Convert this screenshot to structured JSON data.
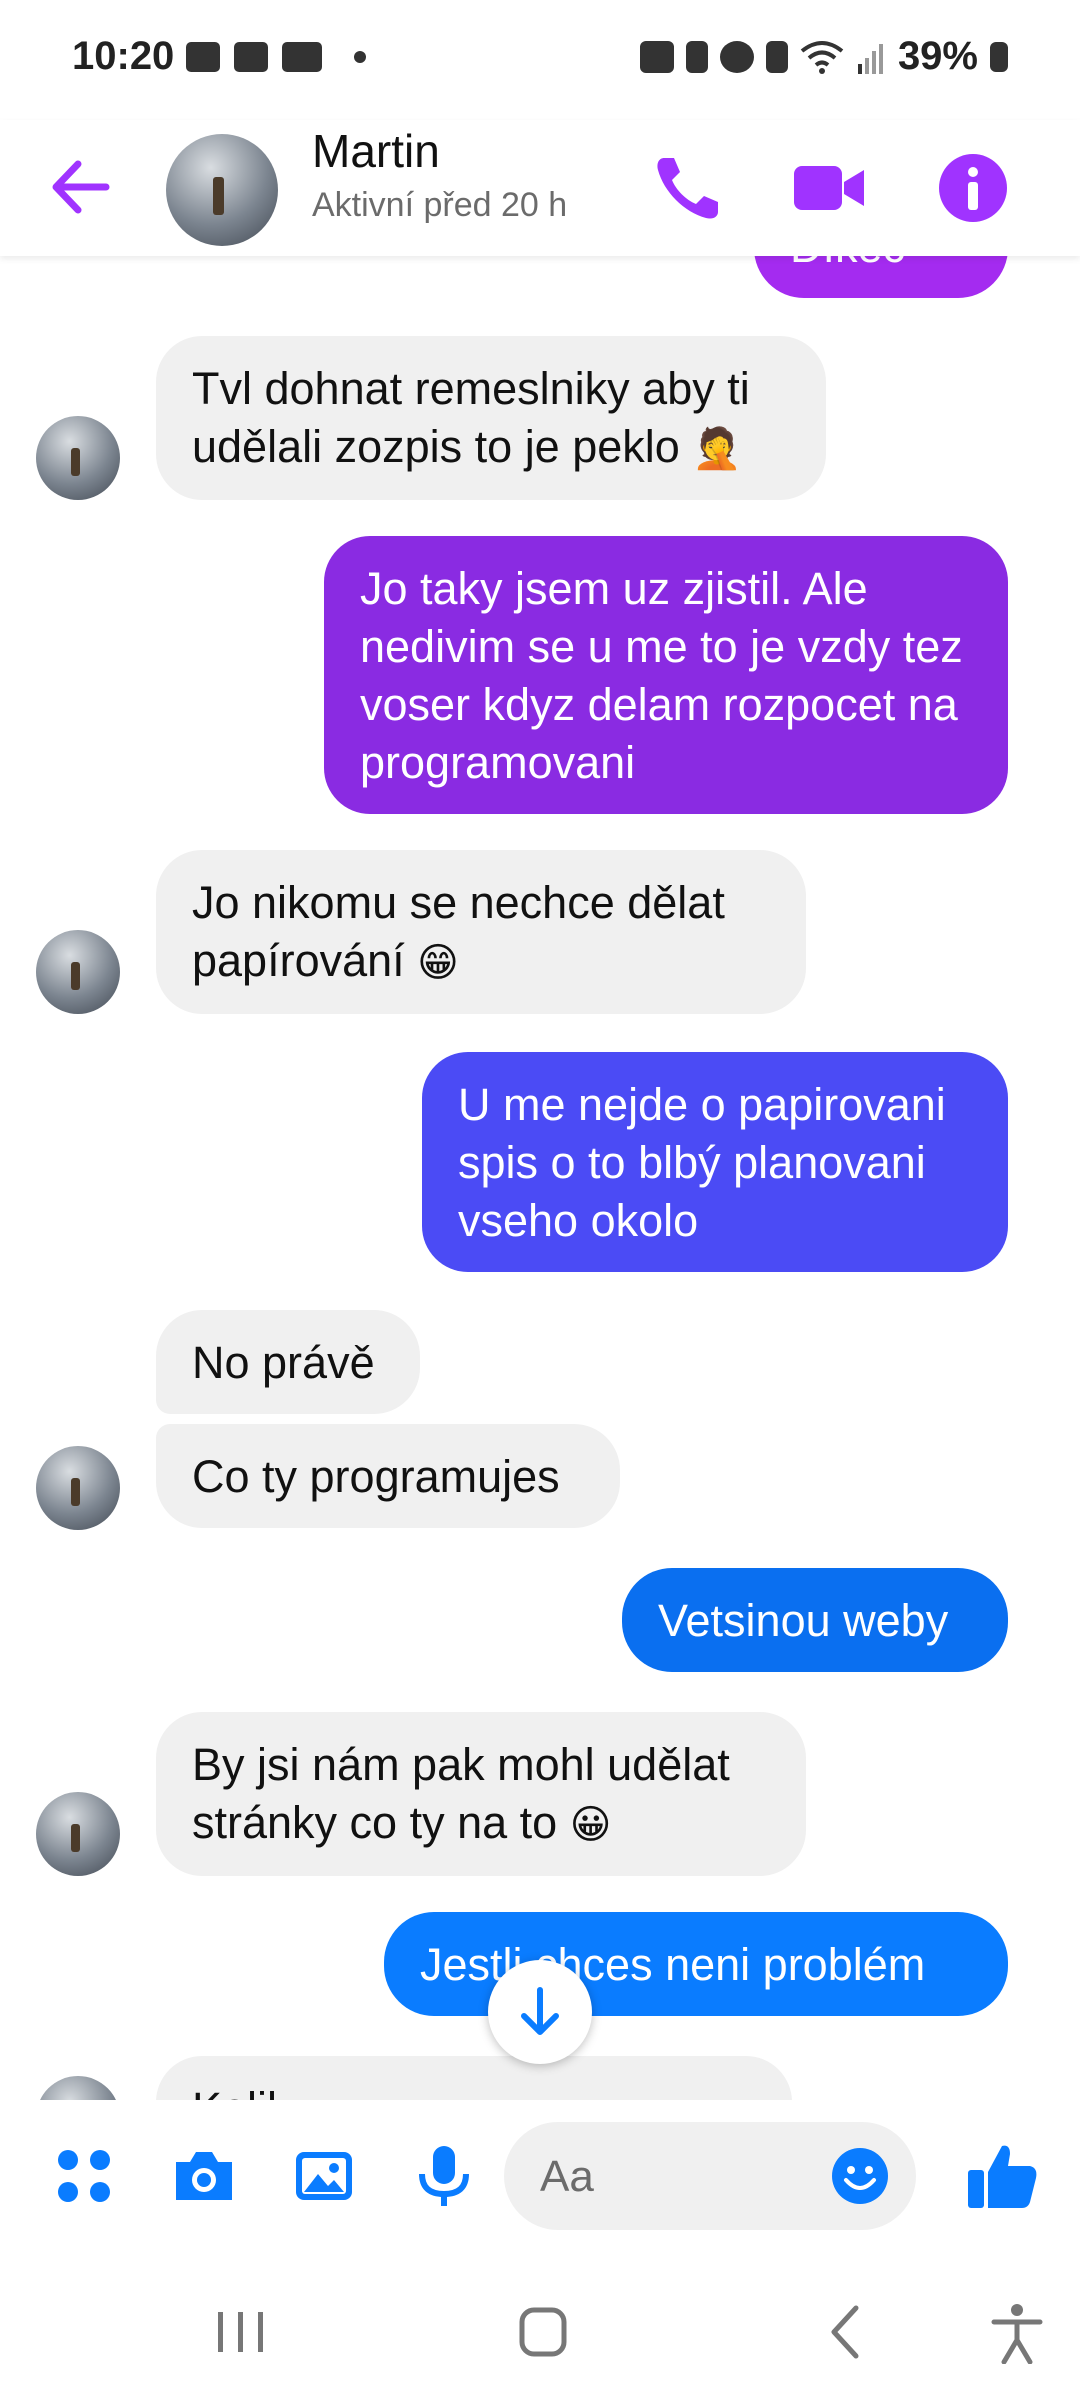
{
  "status_bar": {
    "time": "10:20",
    "battery": "39%",
    "left_icons": [
      "image-icon",
      "phone-device-icon",
      "youtube-icon",
      "dot-icon"
    ],
    "right_icons": [
      "key-icon",
      "battery-saver-icon",
      "alarm-icon",
      "bluetooth-icon",
      "wifi-icon",
      "signal-icon",
      "battery-icon"
    ]
  },
  "header": {
    "name": "Martin",
    "status": "Aktivní před 20 h",
    "accent": "#a033ff"
  },
  "thread": {
    "partial_top": "Díkec",
    "messages": [
      {
        "from": "contact",
        "text": "Tvl dohnat remeslniky aby ti udělali zozpis to je peklo",
        "emoji": "🤦"
      },
      {
        "from": "me",
        "text": "Jo taky jsem uz zjistil. Ale nedivim se u me to je vzdy tez voser kdyz delam rozpocet na programovani"
      },
      {
        "from": "contact",
        "text": "Jo nikomu se nechce dělat papírování",
        "emoji": "😁"
      },
      {
        "from": "me",
        "text": "U me nejde o papirovani spis o to blbý planovani vseho okolo"
      },
      {
        "from": "contact",
        "text": "No právě"
      },
      {
        "from": "contact",
        "text": "Co ty programujes"
      },
      {
        "from": "me",
        "text": "Vetsinou weby"
      },
      {
        "from": "contact",
        "text": "By jsi nám pak mohl udělat stránky co ty na to",
        "emoji": "😀"
      },
      {
        "from": "me",
        "text": "Jestli chces neni problém"
      }
    ],
    "partial_bottom": "Kolik ..."
  },
  "composer": {
    "placeholder": "Aa",
    "accent": "#0a7cff"
  },
  "colors": {
    "bubble_in": "#f0f0f0",
    "bubble_purple": "#8a2be2",
    "bubble_indigo": "#4b4bf5",
    "bubble_blue": "#0a7cff"
  }
}
